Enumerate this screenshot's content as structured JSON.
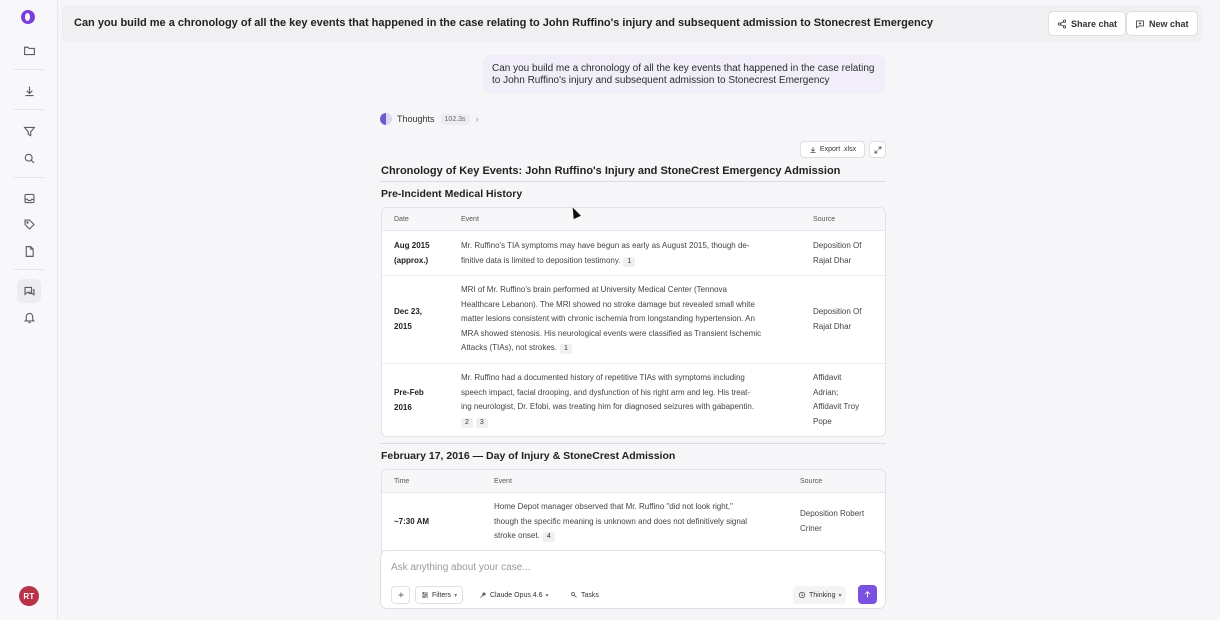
{
  "header": {
    "title": "Can you build me a chronology of all the key events that happened in the case relating to John Ruffino's injury and subsequent admission to Stonecrest Emergency",
    "share_label": "Share chat",
    "new_label": "New chat"
  },
  "sidebar": {
    "avatar_initials": "RT",
    "items": [
      "folder-icon",
      "download-icon",
      "filter-icon",
      "search-icon",
      "inbox-icon",
      "tag-icon",
      "document-icon",
      "chat-icon",
      "bell-icon"
    ]
  },
  "message": {
    "user_text": "Can you build me a chronology of all the key events that happened in the case relating to John Ruffino's injury and subsequent admission to Stonecrest Emergency"
  },
  "thoughts": {
    "label": "Thoughts",
    "duration": "102.3s"
  },
  "toolbar": {
    "export_label": "Export .xlsx"
  },
  "doc": {
    "title": "Chronology of Key Events: John Ruffino's Injury and StoneCrest Emergency Admission",
    "section1": {
      "title": "Pre-Incident Medical History",
      "headers": {
        "date": "Date",
        "event": "Event",
        "source": "Source"
      },
      "rows": [
        {
          "date": [
            "Aug 2015",
            "(approx.)"
          ],
          "event": [
            "Mr. Ruffino's TIA symptoms may have begun as early as August 2015, though de-",
            "finitive data is limited to deposition testimony."
          ],
          "cites": [
            "1"
          ],
          "source": [
            "Deposition Of",
            "Rajat Dhar"
          ]
        },
        {
          "date": [
            "Dec 23,",
            "2015"
          ],
          "event": [
            "MRI of Mr. Ruffino's brain performed at University Medical Center (Tennova",
            "Healthcare Lebanon). The MRI showed no stroke damage but revealed small white",
            "matter lesions consistent with chronic ischemia from longstanding hypertension. An",
            "MRA showed stenosis. His neurological events were classified as Transient Ischemic",
            "Attacks (TIAs), not strokes."
          ],
          "cites": [
            "1"
          ],
          "source": [
            "Deposition Of",
            "Rajat Dhar"
          ]
        },
        {
          "date": [
            "Pre-Feb",
            "2016"
          ],
          "event": [
            "Mr. Ruffino had a documented history of repetitive TIAs with symptoms including",
            "speech impact, facial drooping, and dysfunction of his right arm and leg. His treat-",
            "ing neurologist, Dr. Efobi, was treating him for diagnosed seizures with gabapentin."
          ],
          "cites": [
            "2",
            "3"
          ],
          "source": [
            "Affidavit",
            "Adrian;",
            "Affidavit Troy",
            "Pope"
          ]
        }
      ]
    },
    "section2": {
      "title": "February 17, 2016 — Day of Injury & StoneCrest Admission",
      "headers": {
        "time": "Time",
        "event": "Event",
        "source": "Source"
      },
      "rows": [
        {
          "time": "~7:30 AM",
          "event": [
            "Home Depot manager observed that Mr. Ruffino \"did not look right,\"",
            "though the specific meaning is unknown and does not definitively signal",
            "stroke onset."
          ],
          "cites": [
            "4"
          ],
          "source": [
            "Deposition Robert",
            "Criner"
          ]
        }
      ]
    }
  },
  "composer": {
    "placeholder": "Ask anything about your case...",
    "filters_label": "Filters",
    "model_label": "Claude Opus 4.6",
    "tasks_label": "Tasks",
    "thinking_label": "Thinking"
  }
}
